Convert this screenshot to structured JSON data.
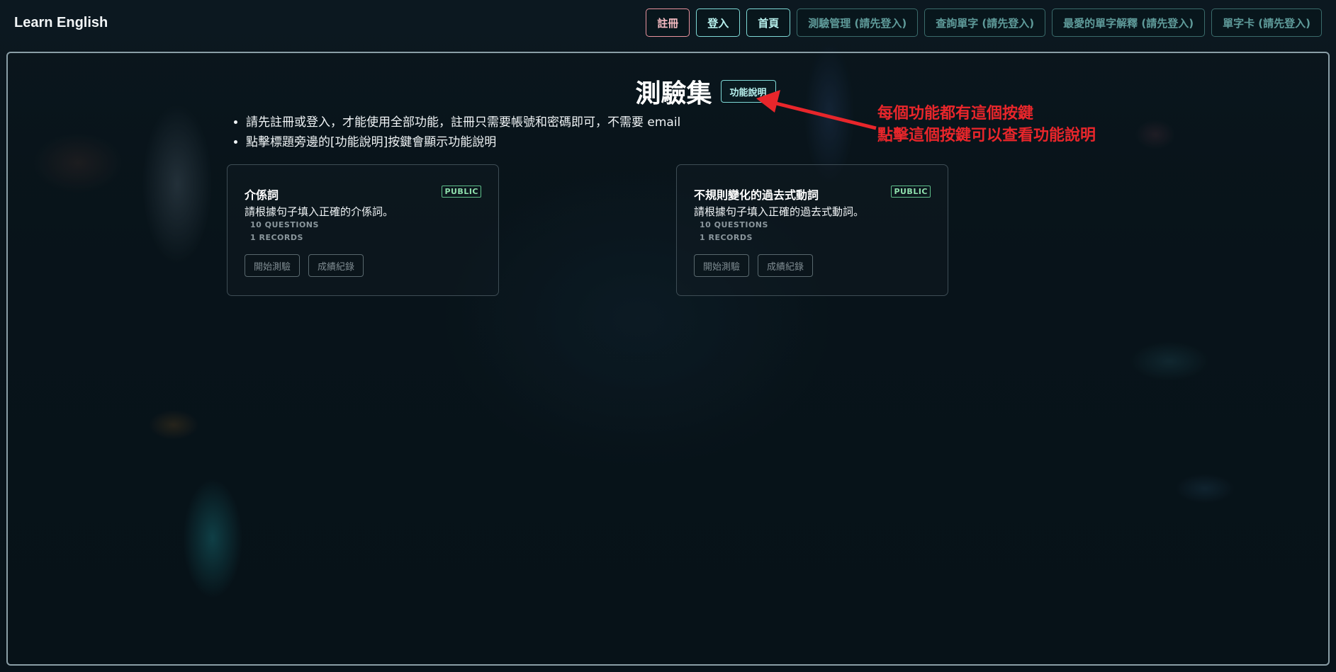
{
  "header": {
    "brand": "Learn English",
    "nav": [
      {
        "label": "註冊"
      },
      {
        "label": "登入"
      },
      {
        "label": "首頁"
      },
      {
        "label": "測驗管理 (請先登入)"
      },
      {
        "label": "查詢單字 (請先登入)"
      },
      {
        "label": "最愛的單字解釋 (請先登入)"
      },
      {
        "label": "單字卡 (請先登入)"
      }
    ]
  },
  "main": {
    "title": "測驗集",
    "help_button": "功能說明",
    "notes": [
      "請先註冊或登入，才能使用全部功能，註冊只需要帳號和密碼即可，不需要 email",
      "點擊標題旁邊的[功能說明]按鍵會顯示功能說明"
    ],
    "annotation": {
      "line1": "每個功能都有這個按鍵",
      "line2": "點擊這個按鍵可以查看功能說明"
    },
    "quizzes": [
      {
        "title": "介係詞",
        "badge": "PUBLIC",
        "description": "請根據句子填入正確的介係詞。",
        "questions": "10 QUESTIONS",
        "records": "1 RECORDS",
        "start_label": "開始測驗",
        "records_label": "成績紀錄"
      },
      {
        "title": "不規則變化的過去式動詞",
        "badge": "PUBLIC",
        "description": "請根據句子填入正確的過去式動詞。",
        "questions": "10 QUESTIONS",
        "records": "1 RECORDS",
        "start_label": "開始測驗",
        "records_label": "成績紀錄"
      }
    ]
  },
  "colors": {
    "accent": "#7ed9d6",
    "register": "#e8929d",
    "annotation": "#e8262b",
    "badge": "#5fbf8a"
  }
}
